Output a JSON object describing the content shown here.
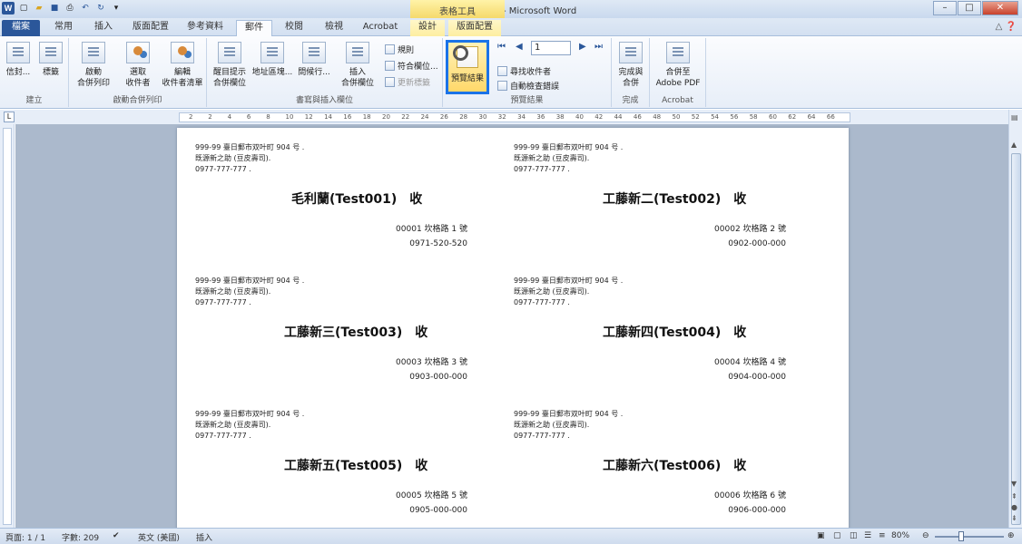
{
  "window": {
    "title": "地址條列印檔 - Microsoft Word",
    "context_tab_header": "表格工具",
    "minimize_label": "–",
    "maximize_label": "□",
    "close_label": "✕"
  },
  "tabs": {
    "file": "檔案",
    "home": "常用",
    "insert": "插入",
    "layout": "版面配置",
    "references": "參考資料",
    "mailings": "郵件",
    "review": "校閱",
    "view": "檢視",
    "acrobat": "Acrobat",
    "design": "設計",
    "table_layout": "版面配置"
  },
  "ribbon": {
    "group_create": "建立",
    "envelopes": "信封...",
    "labels": "標籤",
    "group_start": "啟動合併列印",
    "start_merge_1": "啟動",
    "start_merge_2": "合併列印",
    "select_recipients_1": "選取",
    "select_recipients_2": "收件者",
    "edit_list_1": "編輯",
    "edit_list_2": "收件者清單",
    "group_write": "書寫與插入欄位",
    "highlight_1": "醒目提示",
    "highlight_2": "合併欄位",
    "address_block": "地址區塊...",
    "greeting_line": "問候行...",
    "insert_field_1": "插入",
    "insert_field_2": "合併欄位",
    "rules": "規則",
    "match_fields": "符合欄位...",
    "update_labels": "更新標籤",
    "group_preview": "預覽結果",
    "preview_results": "預覽結果",
    "record_number": "1",
    "find_recipient": "尋找收件者",
    "auto_check": "自動檢查錯誤",
    "group_finish": "完成",
    "finish_1": "完成與",
    "finish_2": "合併",
    "group_acrobat": "Acrobat",
    "merge_pdf_1": "合併至",
    "merge_pdf_2": "Adobe PDF"
  },
  "ruler_ticks": [
    "2",
    "2",
    "4",
    "6",
    "8",
    "10",
    "12",
    "14",
    "16",
    "18",
    "20",
    "22",
    "24",
    "26",
    "28",
    "30",
    "32",
    "34",
    "36",
    "38",
    "40",
    "42",
    "44",
    "46",
    "48",
    "50",
    "52",
    "54",
    "56",
    "58",
    "60",
    "62",
    "64",
    "66"
  ],
  "labels": [
    {
      "ret1": "999-99 臺日郵市双叶町 904 号 .",
      "ret2": "既源新之助 (豆皮壽司).",
      "ret3": "0977-777-777 .",
      "name": "毛利蘭(Test001)　收",
      "addr": "00001 坎格路 1 號",
      "phone": "0971-520-520"
    },
    {
      "ret1": "999-99 臺日郵市双叶町 904 号 .",
      "ret2": "既源新之助 (豆皮壽司).",
      "ret3": "0977-777-777 .",
      "name": "工藤新二(Test002)　收",
      "addr": "00002 坎格路 2 號",
      "phone": "0902-000-000"
    },
    {
      "ret1": "999-99 臺日郵市双叶町 904 号 .",
      "ret2": "既源新之助 (豆皮壽司).",
      "ret3": "0977-777-777 .",
      "name": "工藤新三(Test003)　收",
      "addr": "00003 坎格路 3 號",
      "phone": "0903-000-000"
    },
    {
      "ret1": "999-99 臺日郵市双叶町 904 号 .",
      "ret2": "既源新之助 (豆皮壽司).",
      "ret3": "0977-777-777 .",
      "name": "工藤新四(Test004)　收",
      "addr": "00004 坎格路 4 號",
      "phone": "0904-000-000"
    },
    {
      "ret1": "999-99 臺日郵市双叶町 904 号 .",
      "ret2": "既源新之助 (豆皮壽司).",
      "ret3": "0977-777-777 .",
      "name": "工藤新五(Test005)　收",
      "addr": "00005 坎格路 5 號",
      "phone": "0905-000-000"
    },
    {
      "ret1": "999-99 臺日郵市双叶町 904 号 .",
      "ret2": "既源新之助 (豆皮壽司).",
      "ret3": "0977-777-777 .",
      "name": "工藤新六(Test006)　收",
      "addr": "00006 坎格路 6 號",
      "phone": "0906-000-000"
    }
  ],
  "status": {
    "page": "頁面: 1 / 1",
    "words": "字數: 209",
    "language": "英文 (美國)",
    "mode": "插入",
    "zoom": "80%"
  }
}
